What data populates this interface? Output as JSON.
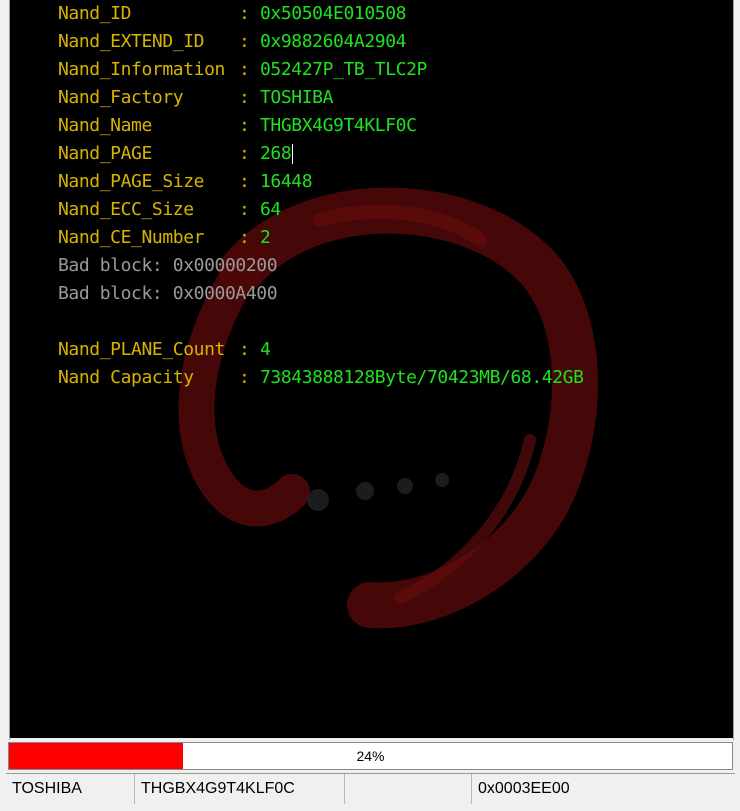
{
  "console": {
    "rows": [
      {
        "key": "Nand_ID",
        "sep": ":",
        "value": "0x50504E010508"
      },
      {
        "key": "Nand_EXTEND_ID",
        "sep": ":",
        "value": "0x9882604A2904"
      },
      {
        "key": "Nand_Information",
        "sep": ":",
        "value": "052427P_TB_TLC2P"
      },
      {
        "key": "Nand_Factory",
        "sep": ":",
        "value": "TOSHIBA"
      },
      {
        "key": "Nand_Name",
        "sep": ":",
        "value": "THGBX4G9T4KLF0C"
      },
      {
        "key": "Nand_PAGE",
        "sep": ":",
        "value": "268"
      },
      {
        "key": "Nand_PAGE_Size",
        "sep": ":",
        "value": "16448"
      },
      {
        "key": "Nand_ECC_Size",
        "sep": ":",
        "value": "64"
      },
      {
        "key": "Nand_CE_Number",
        "sep": ":",
        "value": "2"
      }
    ],
    "bad_blocks": [
      "Bad block: 0x00000200",
      "Bad block: 0x0000A400"
    ],
    "rows2": [
      {
        "key": "Nand_PLANE_Count",
        "sep": ":",
        "value": "4"
      },
      {
        "key": "Nand Capacity",
        "sep": ":",
        "value": "73843888128Byte/70423MB/68.42GB"
      }
    ]
  },
  "progress": {
    "value": 0.24,
    "label": "24%"
  },
  "status_bar": {
    "factory": "TOSHIBA",
    "name": "THGBX4G9T4KLF0C",
    "field3": "",
    "address": "0x0003EE00"
  },
  "colors": {
    "key": "#d6b400",
    "value": "#1ee21e",
    "bad": "#9a9a9a",
    "progress": "#ff0000",
    "logo": "#5a0a0a"
  },
  "icons": [
    "enso-logo"
  ]
}
